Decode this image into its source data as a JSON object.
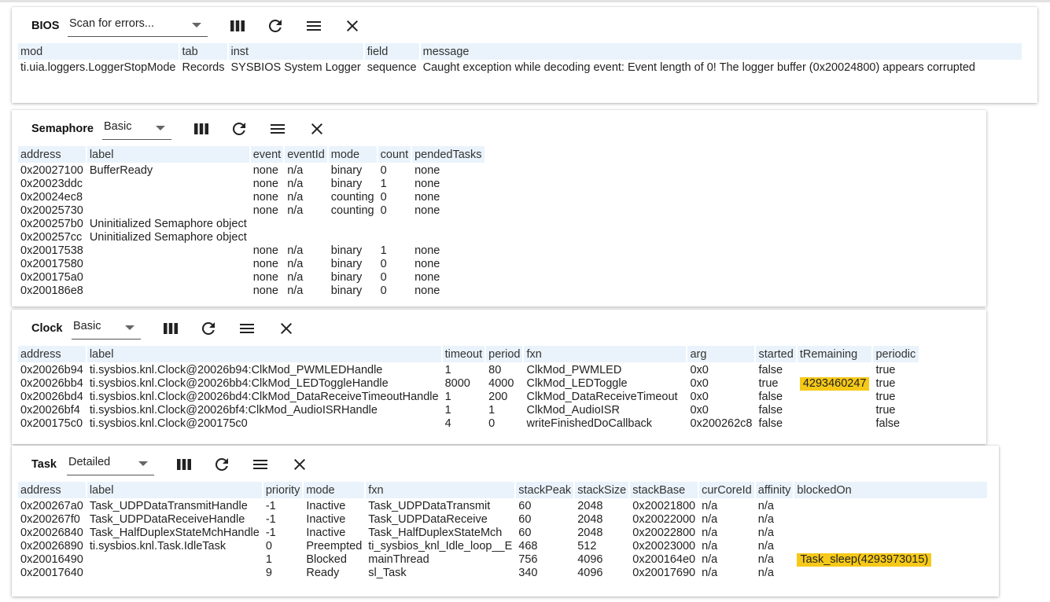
{
  "bios": {
    "title": "BIOS",
    "view": "Scan for errors...",
    "columns": [
      "mod",
      "tab",
      "inst",
      "field",
      "message"
    ],
    "rows": [
      [
        "ti.uia.loggers.LoggerStopMode",
        "Records",
        "SYSBIOS System Logger",
        "sequence",
        "Caught exception while decoding event: Event length of 0! The logger buffer (0x20024800) appears corrupted"
      ]
    ]
  },
  "semaphore": {
    "title": "Semaphore",
    "view": "Basic",
    "columns": [
      "address",
      "label",
      "event",
      "eventId",
      "mode",
      "count",
      "pendedTasks"
    ],
    "rows": [
      [
        "0x20027100",
        "BufferReady",
        "none",
        "n/a",
        "binary",
        "0",
        "none"
      ],
      [
        "0x20023ddc",
        "",
        "none",
        "n/a",
        "binary",
        "1",
        "none"
      ],
      [
        "0x20024ec8",
        "",
        "none",
        "n/a",
        "counting",
        "0",
        "none"
      ],
      [
        "0x20025730",
        "",
        "none",
        "n/a",
        "counting",
        "0",
        "none"
      ],
      [
        "0x200257b0",
        "Uninitialized Semaphore object",
        "",
        "",
        "",
        "",
        ""
      ],
      [
        "0x200257cc",
        "Uninitialized Semaphore object",
        "",
        "",
        "",
        "",
        ""
      ],
      [
        "0x20017538",
        "",
        "none",
        "n/a",
        "binary",
        "1",
        "none"
      ],
      [
        "0x20017580",
        "",
        "none",
        "n/a",
        "binary",
        "0",
        "none"
      ],
      [
        "0x200175a0",
        "",
        "none",
        "n/a",
        "binary",
        "0",
        "none"
      ],
      [
        "0x200186e8",
        "",
        "none",
        "n/a",
        "binary",
        "0",
        "none"
      ]
    ]
  },
  "clock": {
    "title": "Clock",
    "view": "Basic",
    "columns": [
      "address",
      "label",
      "timeout",
      "period",
      "fxn",
      "arg",
      "started",
      "tRemaining",
      "periodic"
    ],
    "highlight_color": "#f6c918",
    "rows": [
      [
        "0x20026b94",
        "ti.sysbios.knl.Clock@20026b94:ClkMod_PWMLEDHandle",
        "1",
        "80",
        "ClkMod_PWMLED",
        "0x0",
        "false",
        "",
        "true"
      ],
      [
        "0x20026bb4",
        "ti.sysbios.knl.Clock@20026bb4:ClkMod_LEDToggleHandle",
        "8000",
        "4000",
        "ClkMod_LEDToggle",
        "0x0",
        "true",
        "4293460247",
        "true"
      ],
      [
        "0x20026bd4",
        "ti.sysbios.knl.Clock@20026bd4:ClkMod_DataReceiveTimeoutHandle",
        "1",
        "200",
        "ClkMod_DataReceiveTimeout",
        "0x0",
        "false",
        "",
        "true"
      ],
      [
        "0x20026bf4",
        "ti.sysbios.knl.Clock@20026bf4:ClkMod_AudioISRHandle",
        "1",
        "1",
        "ClkMod_AudioISR",
        "0x0",
        "false",
        "",
        "true"
      ],
      [
        "0x200175c0",
        "ti.sysbios.knl.Clock@200175c0",
        "4",
        "0",
        "writeFinishedDoCallback",
        "0x200262c8",
        "false",
        "",
        "false"
      ]
    ],
    "highlighted_cells": [
      [
        1,
        7
      ]
    ]
  },
  "task": {
    "title": "Task",
    "view": "Detailed",
    "columns": [
      "address",
      "label",
      "priority",
      "mode",
      "fxn",
      "stackPeak",
      "stackSize",
      "stackBase",
      "curCoreId",
      "affinity",
      "blockedOn"
    ],
    "rows": [
      [
        "0x200267a0",
        "Task_UDPDataTransmitHandle",
        "-1",
        "Inactive",
        "Task_UDPDataTransmit",
        "60",
        "2048",
        "0x20021800",
        "n/a",
        "n/a",
        ""
      ],
      [
        "0x200267f0",
        "Task_UDPDataReceiveHandle",
        "-1",
        "Inactive",
        "Task_UDPDataReceive",
        "60",
        "2048",
        "0x20022000",
        "n/a",
        "n/a",
        ""
      ],
      [
        "0x20026840",
        "Task_HalfDuplexStateMchHandle",
        "-1",
        "Inactive",
        "Task_HalfDuplexStateMch",
        "60",
        "2048",
        "0x20022800",
        "n/a",
        "n/a",
        ""
      ],
      [
        "0x20026890",
        "ti.sysbios.knl.Task.IdleTask",
        "0",
        "Preempted",
        "ti_sysbios_knl_Idle_loop__E",
        "468",
        "512",
        "0x20023000",
        "n/a",
        "n/a",
        ""
      ],
      [
        "0x20016490",
        "",
        "1",
        "Blocked",
        "mainThread",
        "756",
        "4096",
        "0x200164e0",
        "n/a",
        "n/a",
        "Task_sleep(4293973015)"
      ],
      [
        "0x20017640",
        "",
        "9",
        "Ready",
        "sl_Task",
        "340",
        "4096",
        "0x20017690",
        "n/a",
        "n/a",
        ""
      ]
    ],
    "highlighted_cells": [
      [
        4,
        10
      ]
    ]
  },
  "icons": [
    "columns-icon",
    "refresh-icon",
    "menu-icon",
    "close-icon"
  ]
}
